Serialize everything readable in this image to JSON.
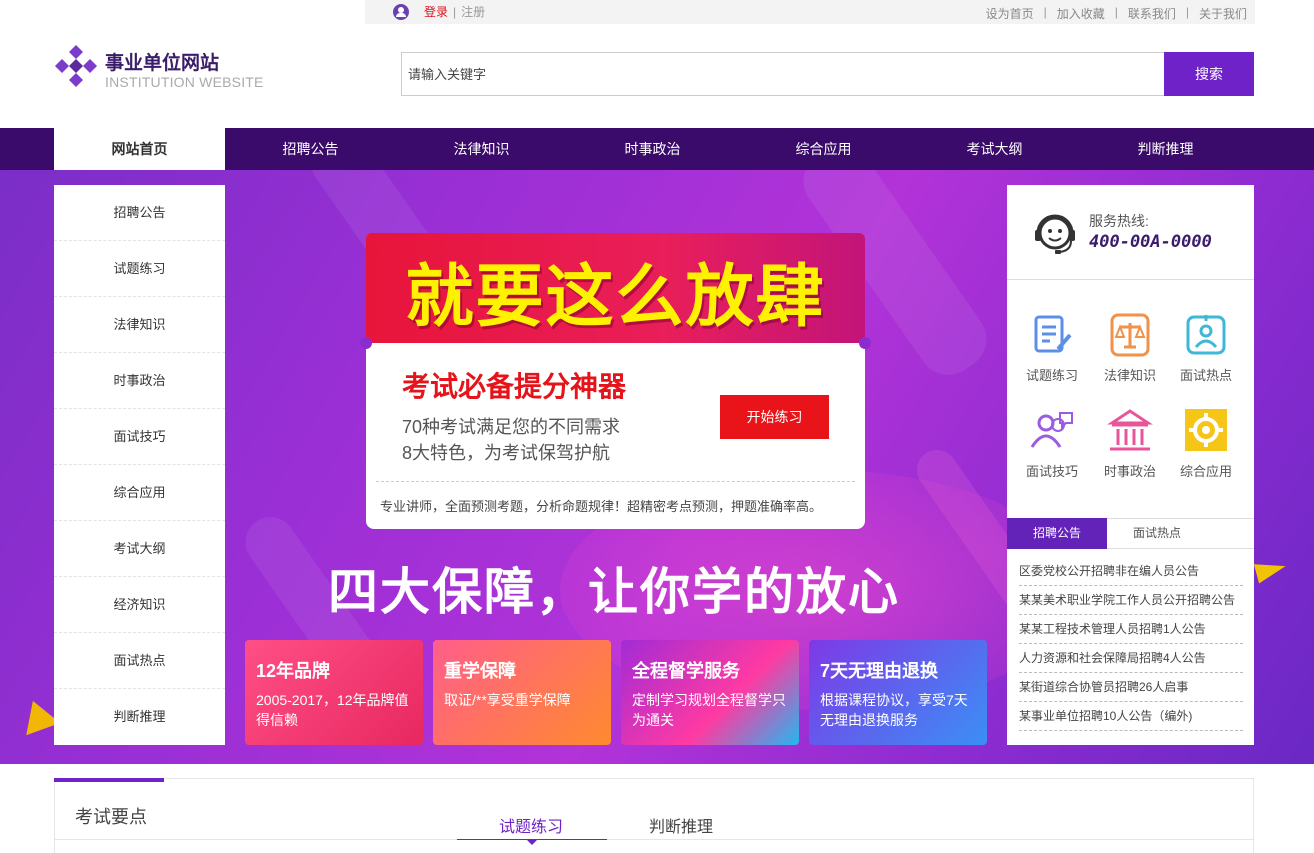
{
  "topbar": {
    "login": "登录",
    "separator": "|",
    "register": "注册",
    "links": [
      "设为首页",
      "加入收藏",
      "联系我们",
      "关于我们"
    ]
  },
  "header": {
    "logo_title": "事业单位网站",
    "logo_subtitle": "INSTITUTION WEBSITE",
    "search_placeholder": "请输入关键字",
    "search_button": "搜索"
  },
  "nav": {
    "items": [
      "网站首页",
      "招聘公告",
      "法律知识",
      "时事政治",
      "综合应用",
      "考试大纲",
      "判断推理"
    ],
    "active_index": 0
  },
  "sidemenu": {
    "items": [
      "招聘公告",
      "试题练习",
      "法律知识",
      "时事政治",
      "面试技巧",
      "综合应用",
      "考试大纲",
      "经济知识",
      "面试热点",
      "判断推理"
    ]
  },
  "promo": {
    "headline": "就要这么放肆",
    "title": "考试必备提分神器",
    "line1": "70种考试满足您的不同需求",
    "line2": "8大特色，为考试保驾护航",
    "button": "开始练习",
    "footer": "专业讲师，全面预测考题，分析命题规律！超精密考点预测，押题准确率高。"
  },
  "slogan": "四大保障，让你学的放心",
  "features": [
    {
      "title": "12年品牌",
      "desc": "2005-2017，12年品牌值得信赖"
    },
    {
      "title": "重学保障",
      "desc": "取证/**享受重学保障"
    },
    {
      "title": "全程督学服务",
      "desc": "定制学习规划全程督学只为通关"
    },
    {
      "title": "7天无理由退换",
      "desc": "根据课程协议，享受7天无理由退换服务"
    }
  ],
  "hotline": {
    "label": "服务热线:",
    "number": "400-00A-0000"
  },
  "quick_links": [
    {
      "label": "试题练习",
      "icon": "exam-notes-icon"
    },
    {
      "label": "法律知识",
      "icon": "law-scales-icon"
    },
    {
      "label": "面试热点",
      "icon": "interview-badge-icon"
    },
    {
      "label": "面试技巧",
      "icon": "people-chat-icon"
    },
    {
      "label": "时事政治",
      "icon": "government-building-icon"
    },
    {
      "label": "综合应用",
      "icon": "gear-icon"
    }
  ],
  "news_tabs": [
    "招聘公告",
    "面试热点"
  ],
  "news": [
    "区委党校公开招聘非在编人员公告",
    "某某美术职业学院工作人员公开招聘公告",
    "某某工程技术管理人员招聘1人公告",
    "人力资源和社会保障局招聘4人公告",
    "某街道综合协管员招聘26人启事",
    "某事业单位招聘10人公告（编外)"
  ],
  "bottom": {
    "title": "考试要点",
    "tabs": [
      "试题练习",
      "判断推理"
    ]
  },
  "colors": {
    "brand_purple": "#7022c9",
    "nav_bg": "#3a0b6a",
    "accent_red": "#e8141a",
    "headline_yellow": "#fff200"
  }
}
